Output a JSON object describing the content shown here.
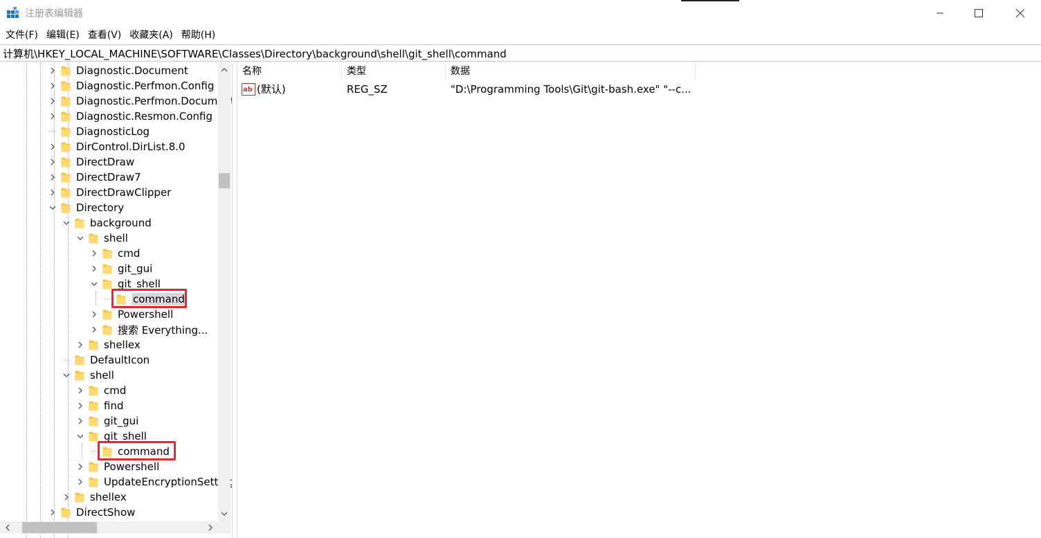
{
  "window": {
    "title": "注册表编辑器"
  },
  "menu": {
    "items": [
      "文件(F)",
      "编辑(E)",
      "查看(V)",
      "收藏夹(A)",
      "帮助(H)"
    ]
  },
  "address": {
    "path": "计算机\\HKEY_LOCAL_MACHINE\\SOFTWARE\\Classes\\Directory\\background\\shell\\git_shell\\command"
  },
  "tree": {
    "items": [
      {
        "label": "Diagnostic.Document",
        "expander": "collapsed"
      },
      {
        "label": "Diagnostic.Perfmon.Config",
        "expander": "collapsed"
      },
      {
        "label": "Diagnostic.Perfmon.Document",
        "expander": "collapsed"
      },
      {
        "label": "Diagnostic.Resmon.Config",
        "expander": "collapsed"
      },
      {
        "label": "DiagnosticLog",
        "expander": "none"
      },
      {
        "label": "DirControl.DirList.8.0",
        "expander": "collapsed"
      },
      {
        "label": "DirectDraw",
        "expander": "collapsed"
      },
      {
        "label": "DirectDraw7",
        "expander": "collapsed"
      },
      {
        "label": "DirectDrawClipper",
        "expander": "collapsed"
      },
      {
        "label": "Directory",
        "expander": "expanded"
      },
      {
        "label": "background",
        "expander": "expanded"
      },
      {
        "label": "shell",
        "expander": "expanded"
      },
      {
        "label": "cmd",
        "expander": "collapsed"
      },
      {
        "label": "git_gui",
        "expander": "collapsed"
      },
      {
        "label": "git_shell",
        "expander": "expanded"
      },
      {
        "label": "command",
        "expander": "none",
        "selected": true
      },
      {
        "label": "Powershell",
        "expander": "collapsed"
      },
      {
        "label": "搜索 Everything...",
        "expander": "collapsed"
      },
      {
        "label": "shellex",
        "expander": "collapsed"
      },
      {
        "label": "DefaultIcon",
        "expander": "none"
      },
      {
        "label": "shell",
        "expander": "expanded"
      },
      {
        "label": "cmd",
        "expander": "collapsed"
      },
      {
        "label": "find",
        "expander": "collapsed"
      },
      {
        "label": "git_gui",
        "expander": "collapsed"
      },
      {
        "label": "git_shell",
        "expander": "expanded"
      },
      {
        "label": "command",
        "expander": "none"
      },
      {
        "label": "Powershell",
        "expander": "collapsed"
      },
      {
        "label": "UpdateEncryptionSettings",
        "expander": "collapsed"
      },
      {
        "label": "shellex",
        "expander": "collapsed"
      },
      {
        "label": "DirectShow",
        "expander": "collapsed"
      }
    ]
  },
  "list": {
    "columns": [
      "名称",
      "类型",
      "数据"
    ],
    "rows": [
      {
        "name": "(默认)",
        "type": "REG_SZ",
        "data": "\"D:\\Programming Tools\\Git\\git-bash.exe\" \"--c..."
      }
    ]
  },
  "colors": {
    "highlight": "#e8262c",
    "folder": "#f5c94a",
    "selection": "#d9d9d9"
  },
  "icons": {
    "app": "registry-editor-icon",
    "folder": "folder-icon",
    "value": "string-value-icon"
  }
}
